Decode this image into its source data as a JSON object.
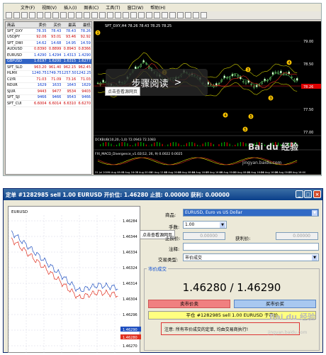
{
  "menubar": {
    "items": [
      "文件(F)",
      "视图(V)",
      "插入(I)",
      "图表(C)",
      "工具(T)",
      "窗口(W)",
      "帮助(H)"
    ]
  },
  "market_watch": {
    "headers": [
      "商品",
      "卖价",
      "买价",
      "最高",
      "最低"
    ],
    "rows": [
      {
        "sym": "SPT_DXY",
        "a": "78.35",
        "b": "78.43",
        "c": "78.43",
        "d": "78.26",
        "dir": "up",
        "sel": false
      },
      {
        "sym": "USDJPY",
        "a": "92.06",
        "b": "93.01",
        "c": "93.46",
        "d": "92.92",
        "dir": "dn",
        "sel": false
      },
      {
        "sym": "SPT_DWI",
        "a": "14.62",
        "b": "14.68",
        "c": "14.95",
        "d": "14.59",
        "dir": "up",
        "sel": false
      },
      {
        "sym": "AUDUSD",
        "a": "0.8390",
        "b": "0.8899",
        "c": "0.8943",
        "d": "0.8366",
        "dir": "dn",
        "sel": false
      },
      {
        "sym": "EURUSD",
        "a": "1.4290",
        "b": "1.4294",
        "c": "1.4313",
        "d": "1.4290",
        "dir": "up",
        "sel": false
      },
      {
        "sym": "GBPUSD",
        "a": "1.6197",
        "b": "1.6200",
        "c": "1.6315",
        "d": "1.6277",
        "dir": "up",
        "sel": true
      },
      {
        "sym": "SPT_SLD",
        "a": "963.20",
        "b": "961.40",
        "c": "962.15",
        "d": "962.45",
        "dir": "dn",
        "sel": false
      },
      {
        "sym": "HLMX",
        "a": "1240.75",
        "b": "1749.75",
        "c": "1257.50",
        "d": "1242.25",
        "dir": "up",
        "sel": false
      },
      {
        "sym": "CLYR",
        "a": "71.03",
        "b": "71.09",
        "c": "73.16",
        "d": "71.03",
        "dir": "dn",
        "sel": false
      },
      {
        "sym": "NDUR",
        "a": "1629",
        "b": "1633",
        "c": "1643",
        "d": "1629",
        "dir": "up",
        "sel": false
      },
      {
        "sym": "SJUR",
        "a": "9443",
        "b": "9477",
        "c": "9534",
        "d": "9403",
        "dir": "dn",
        "sel": false
      },
      {
        "sym": "SPT_SJI",
        "a": "9466",
        "b": "9466",
        "c": "9543",
        "d": "9466",
        "dir": "up",
        "sel": false
      },
      {
        "sym": "SPT_CUI",
        "a": "6.6004",
        "b": "6.6014",
        "c": "6.6310",
        "d": "6.6270",
        "dir": "dn",
        "sel": false
      }
    ]
  },
  "chart_top": {
    "title": "SPT_DXY,H4  78.26 78.43 78.25 78.25",
    "indicator1": "DCKBUB(10,20,-1,0) 72.0943 72.1083",
    "indicator2": "FXI_MACD_Divergence_v1.02(12, 26, 9) 0.0022 0.0025",
    "price_ticks": [
      "79.00",
      "78.50",
      "78.00",
      "77.50",
      "77.00"
    ],
    "highlight_price": "78.26",
    "time_ticks": [
      "31 Jul 2009",
      "4 Aug 08:00",
      "5 Aug 16:00",
      "7 Aug 00:00",
      "10 Aug 12:00",
      "12 Aug 00:00",
      "13 Aug 08:00",
      "14 Aug 16:00",
      "17 Aug 16:00",
      "19 Aug 00:00",
      "20 Aug 08:00",
      "21 Aug 16:00",
      "24 Aug 16:00",
      "26 Aug 00:00",
      "27 Aug 16:00"
    ],
    "wave_labels": [
      "1",
      "2",
      "3",
      "4",
      "5",
      "3",
      "4",
      "5"
    ]
  },
  "overlay": {
    "text": "步骤阅读",
    "arrow": ">",
    "tip": "点击查看源网页"
  },
  "watermark": {
    "brand": "Bai du 经验",
    "url": "jingyan.baidu.com"
  },
  "dialog": {
    "title": "定单 #1282985 sell 1.00 EURUSD 开价位: 1.46280 止损: 0.00000 获利: 0.00000",
    "chart_symbol": "EURUSD",
    "chart_ticks": [
      "1.46284",
      "1.46344",
      "1.46334",
      "1.46324",
      "1.46314",
      "1.46304",
      "1.46296",
      "1.46286",
      "1.46270"
    ],
    "tip": "点击查看源网页",
    "symbol_label": "商品:",
    "symbol_value": "EURUSD, Euro vs US Dollar",
    "volume_label": "手数:",
    "volume_value": "1.00",
    "sl_label": "止损价:",
    "sl_value": "0.00000",
    "tp_label": "获利价:",
    "tp_value": "0.00000",
    "comment_label": "注释:",
    "type_label": "交易类型:",
    "type_value": "市价成交",
    "group_label": "市价成交",
    "price_text": "1.46280 / 1.46290",
    "sell_btn": "卖市价卖",
    "buy_btn": "买市价买",
    "close_btn": "平仓 #1282985 sell 1.00 EURUSD 于市价",
    "note": "注意: 所有市价成交的定单, 均由交易商执行!"
  },
  "colors": {
    "sell_line": "#2050c0",
    "buy_line": "#e03020",
    "chart_bg": "#000000"
  }
}
